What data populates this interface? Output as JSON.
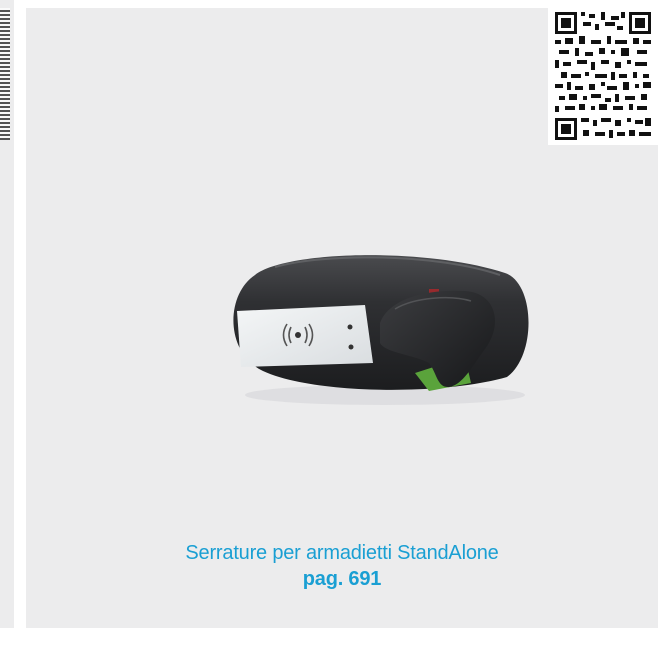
{
  "caption": {
    "title": "Serrature per armadietti StandAlone",
    "page_ref": "pag. 691"
  },
  "qr_code": {
    "icon": "qr-code-icon"
  },
  "product_image": {
    "icon": "cabinet-lock-image"
  },
  "colors": {
    "accent": "#1a9fd3",
    "card_background": "#ececed",
    "lock_body": "#2b2c2e",
    "rfid_plate": "#e9ecee"
  }
}
